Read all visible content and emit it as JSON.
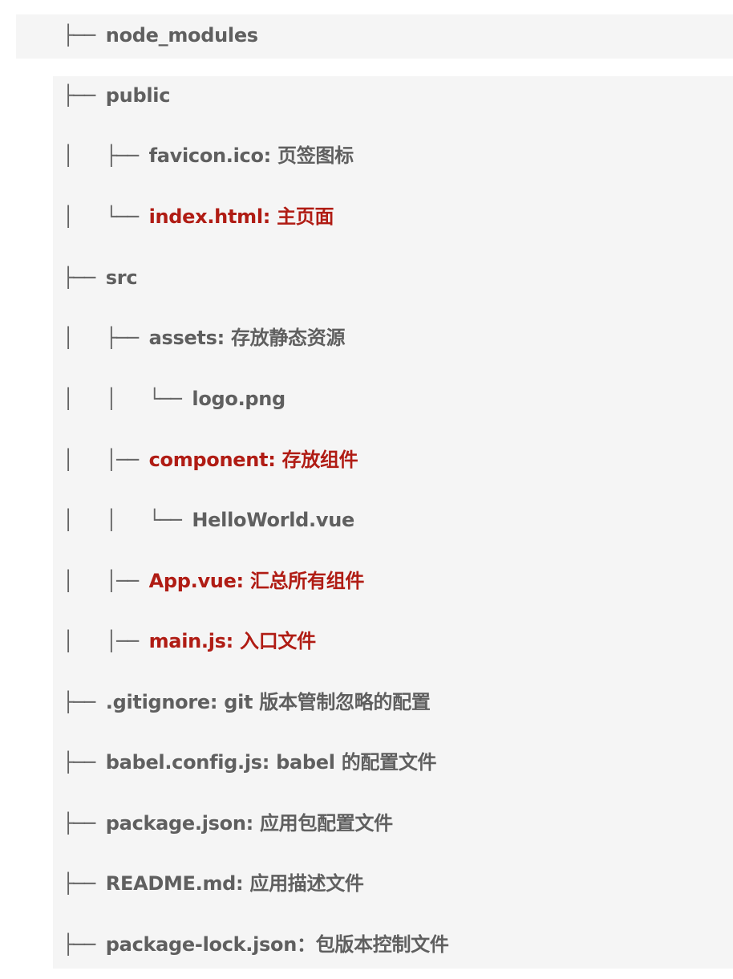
{
  "tree": {
    "lines": [
      {
        "prefix": "├── ",
        "label": "node_modules",
        "highlight": false
      },
      {
        "prefix": "├── ",
        "label": "public",
        "highlight": false
      },
      {
        "prefix": "│   ├── ",
        "label": "favicon.ico: 页签图标",
        "highlight": false
      },
      {
        "prefix": "│   └── ",
        "label": "index.html: 主页面",
        "highlight": true
      },
      {
        "prefix": "├── ",
        "label": "src",
        "highlight": false
      },
      {
        "prefix": "│   ├── ",
        "label": "assets: 存放静态资源",
        "highlight": false
      },
      {
        "prefix": "│   │   └── ",
        "label": "logo.png",
        "highlight": false
      },
      {
        "prefix": "│   │── ",
        "label": "component: 存放组件",
        "highlight": true
      },
      {
        "prefix": "│   │   └── ",
        "label": "HelloWorld.vue",
        "highlight": false
      },
      {
        "prefix": "│   │── ",
        "label": "App.vue: 汇总所有组件",
        "highlight": true
      },
      {
        "prefix": "│   │── ",
        "label": "main.js: 入口文件",
        "highlight": true
      },
      {
        "prefix": "├── ",
        "label": ".gitignore: git 版本管制忽略的配置",
        "highlight": false
      },
      {
        "prefix": "├── ",
        "label": "babel.config.js: babel 的配置文件",
        "highlight": false
      },
      {
        "prefix": "├── ",
        "label": "package.json: 应用包配置文件",
        "highlight": false
      },
      {
        "prefix": "├── ",
        "label": "README.md: 应用描述文件",
        "highlight": false
      },
      {
        "prefix": "├── ",
        "label": "package-lock.json：包版本控制文件",
        "highlight": false
      }
    ]
  },
  "colors": {
    "text": "#5f5f5f",
    "highlight": "#b01c14",
    "panel": "#f5f5f5"
  }
}
